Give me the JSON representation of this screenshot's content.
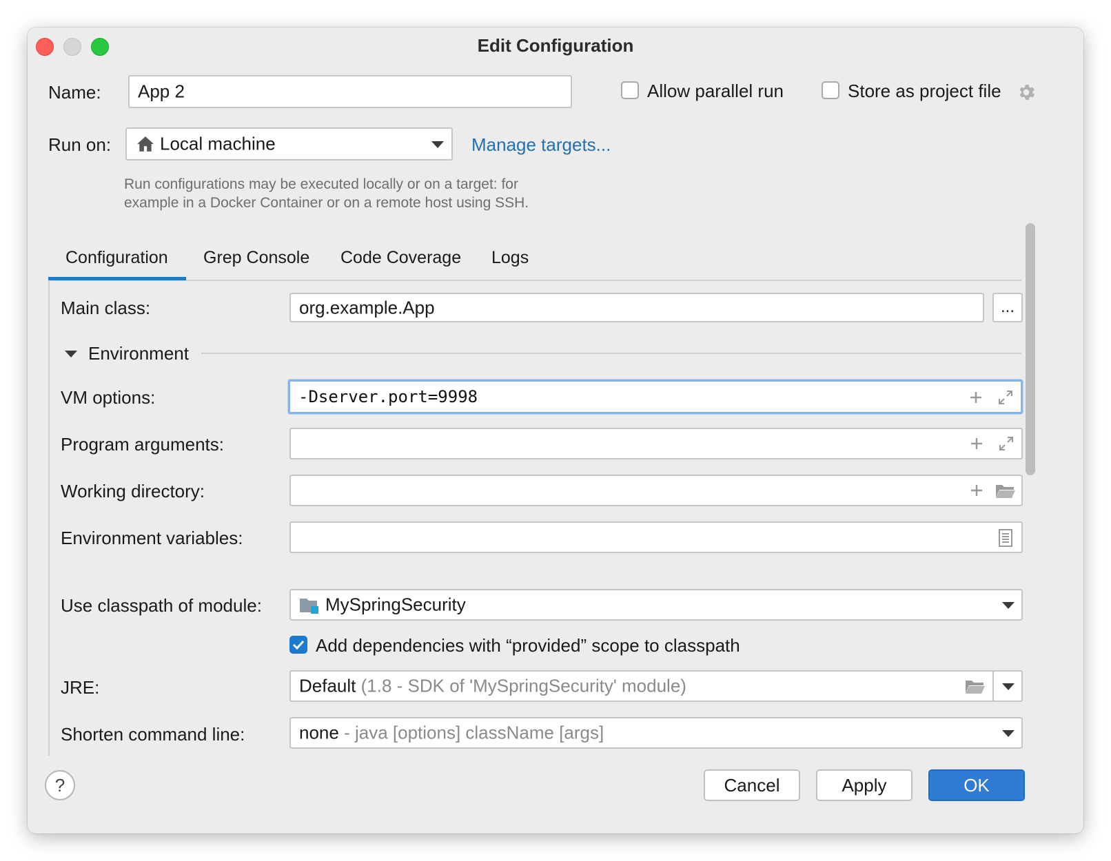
{
  "window": {
    "title": "Edit Configuration"
  },
  "name_row": {
    "label": "Name:",
    "value": "App 2"
  },
  "options": {
    "parallel_label": "Allow parallel run",
    "parallel_checked": false,
    "store_label": "Store as project file",
    "store_checked": false
  },
  "run_on": {
    "label": "Run on:",
    "value": "Local machine",
    "manage_link": "Manage targets...",
    "hint_line1": "Run configurations may be executed locally or on a target: for",
    "hint_line2": "example in a Docker Container or on a remote host using SSH."
  },
  "tabs": [
    {
      "label": "Configuration",
      "active": true
    },
    {
      "label": "Grep Console",
      "active": false
    },
    {
      "label": "Code Coverage",
      "active": false
    },
    {
      "label": "Logs",
      "active": false
    }
  ],
  "config": {
    "main_class_label": "Main class:",
    "main_class_value": "org.example.App",
    "browse_label": "...",
    "environment_label": "Environment",
    "vm_label": "VM options:",
    "vm_value": "-Dserver.port=9998",
    "prog_args_label": "Program arguments:",
    "prog_args_value": "",
    "workdir_label": "Working directory:",
    "workdir_value": "",
    "env_vars_label": "Environment variables:",
    "env_vars_value": "",
    "classpath_label": "Use classpath of module:",
    "classpath_value": "MySpringSecurity",
    "provided_label": "Add dependencies with “provided” scope to classpath",
    "provided_checked": true,
    "jre_label": "JRE:",
    "jre_value": "Default",
    "jre_detail": "(1.8 - SDK of 'MySpringSecurity' module)",
    "shorten_label": "Shorten command line:",
    "shorten_value": "none",
    "shorten_detail": "- java [options] className [args]"
  },
  "buttons": {
    "help": "?",
    "cancel": "Cancel",
    "apply": "Apply",
    "ok": "OK"
  },
  "colors": {
    "accent": "#1b7bd1",
    "link": "#2470b3",
    "close": "#fe5f57",
    "maximize": "#28c840",
    "ok_button": "#2e7cd6"
  }
}
